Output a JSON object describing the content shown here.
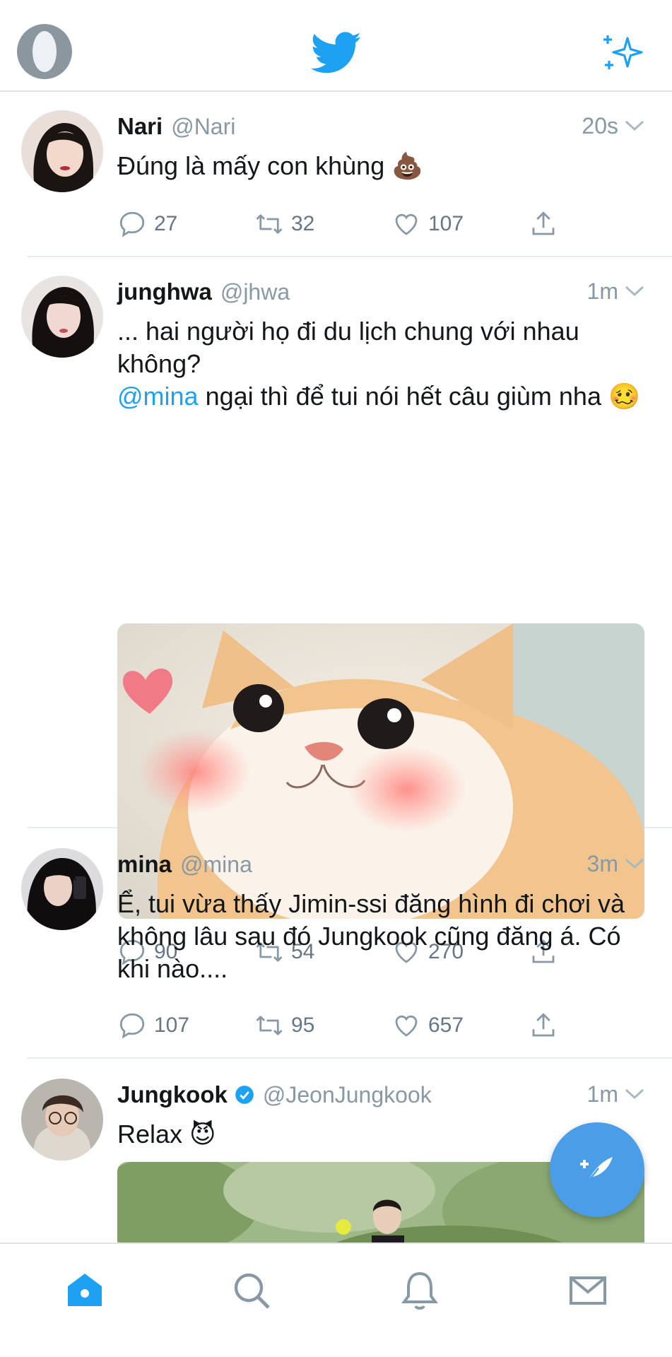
{
  "colors": {
    "accent": "#1da1f2",
    "icon_grey": "#8899a6",
    "text": "#14171a",
    "fab": "#4a9ee8"
  },
  "header": {
    "left_icon": "profile-avatar",
    "center_icon": "twitter-bird-icon",
    "right_icon": "sparkle-icon"
  },
  "tweets": [
    {
      "name": "Nari",
      "handle": "@Nari",
      "time": "20s",
      "text": "Đúng là mấy con khùng 💩",
      "replies": "27",
      "retweets": "32",
      "likes": "107"
    },
    {
      "name": "junghwa",
      "handle": "@jhwa",
      "time": "1m",
      "text_line1": "... hai người họ đi du lịch chung với nhau không?",
      "mention": "@mina",
      "text_line2": " ngại thì để tui nói hết câu giùm nha 🥴",
      "replies": "90",
      "retweets": "54",
      "likes": "270"
    },
    {
      "name": "mina",
      "handle": "@mina",
      "time": "3m",
      "text": "Ể, tui vừa thấy Jimin-ssi đăng hình đi chơi và không lâu sau đó Jungkook cũng đăng á. Có khi nào....",
      "replies": "107",
      "retweets": "95",
      "likes": "657"
    },
    {
      "name": "Jungkook",
      "handle": "@JeonJungkook",
      "time": "1m",
      "text": "Relax 😈",
      "verified": true
    }
  ],
  "tabs": [
    "home-icon",
    "search-icon",
    "notifications-icon",
    "messages-icon"
  ]
}
